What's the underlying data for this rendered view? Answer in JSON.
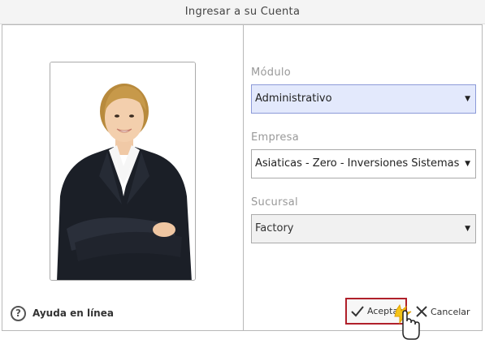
{
  "window": {
    "title": "Ingresar a su Cuenta"
  },
  "left_panel": {
    "photo": {
      "alt": "businesswoman-photo"
    },
    "help": {
      "icon": "help-circle-icon",
      "label": "Ayuda en línea"
    }
  },
  "form": {
    "modulo": {
      "label": "Módulo",
      "value": "Administrativo"
    },
    "empresa": {
      "label": "Empresa",
      "value": "Asiaticas - Zero - Inversiones Sistemas"
    },
    "sucursal": {
      "label": "Sucursal",
      "value": "Factory"
    }
  },
  "actions": {
    "accept_label": "Aceptar",
    "cancel_label": "Cancelar",
    "accept_icon": "checkmark-icon",
    "cancel_icon": "close-icon"
  },
  "colors": {
    "accent_highlight": "#b0202a",
    "selected_field_bg": "#e3e9fc"
  }
}
